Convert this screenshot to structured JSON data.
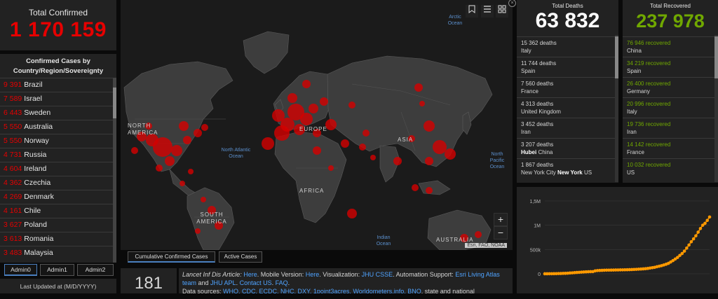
{
  "total_confirmed": {
    "label": "Total Confirmed",
    "value": "1 170 159"
  },
  "country_list": {
    "header": "Confirmed Cases by Country/Region/Sovereignty",
    "items": [
      {
        "value": "9 391",
        "name": "Brazil"
      },
      {
        "value": "7 589",
        "name": "Israel"
      },
      {
        "value": "6 443",
        "name": "Sweden"
      },
      {
        "value": "5 550",
        "name": "Australia"
      },
      {
        "value": "5 550",
        "name": "Norway"
      },
      {
        "value": "4 731",
        "name": "Russia"
      },
      {
        "value": "4 604",
        "name": "Ireland"
      },
      {
        "value": "4 362",
        "name": "Czechia"
      },
      {
        "value": "4 269",
        "name": "Denmark"
      },
      {
        "value": "4 161",
        "name": "Chile"
      },
      {
        "value": "3 627",
        "name": "Poland"
      },
      {
        "value": "3 613",
        "name": "Romania"
      },
      {
        "value": "3 483",
        "name": "Malaysia"
      }
    ]
  },
  "admin_tabs": [
    "Admin0",
    "Admin1",
    "Admin2"
  ],
  "last_updated": {
    "label": "Last Updated at (M/D/YYYY)"
  },
  "map": {
    "labels": {
      "arctic": "Arctic Ocean",
      "north_america": "NORTH AMERICA",
      "europe": "EUROPE",
      "asia": "ASIA",
      "africa": "AFRICA",
      "south_america": "SOUTH AMERICA",
      "australia": "AUSTRALIA",
      "north_atlantic": "North Atlantic Ocean",
      "north_pacific": "North Pacific Ocean",
      "indian": "Indian Ocean"
    },
    "attribution": "Esri, FAO, NOAA",
    "zoom_in": "+",
    "zoom_out": "−",
    "tabs": [
      "Cumulative Confirmed Cases",
      "Active Cases"
    ]
  },
  "countries_count": "181",
  "info": {
    "t1": "Lancet Inf Dis Article: ",
    "l1": "Here",
    "t2": ". Mobile Version: ",
    "l2": "Here",
    "t3": ". Visualization: ",
    "l3": "JHU CSSE",
    "t4": ". Automation Support: ",
    "l4": "Esri Living Atlas team",
    "t5": " and ",
    "l5": "JHU APL",
    "t6": ". ",
    "l6": "Contact US",
    "t7": ". ",
    "l7": "FAQ",
    "t8": ".",
    "t9": "Data sources: ",
    "l9": "WHO, CDC, ECDC, NHC, DXY, 1point3acres, Worldometers.info, BNO",
    "t10": ", state and national"
  },
  "deaths": {
    "label": "Total Deaths",
    "value": "63 832",
    "items": [
      {
        "value": "15 362 deaths",
        "place": "Italy"
      },
      {
        "value": "11 744 deaths",
        "place": "Spain"
      },
      {
        "value": "7 560 deaths",
        "place": "France"
      },
      {
        "value": "4 313 deaths",
        "place": "United Kingdom"
      },
      {
        "value": "3 452 deaths",
        "place": "Iran"
      },
      {
        "value": "3 207 deaths",
        "bold": "Hubei",
        "place": "China"
      },
      {
        "value": "1 867 deaths",
        "prefix": "New York City ",
        "bold": "New York",
        "place": "US"
      }
    ]
  },
  "recovered": {
    "label": "Total Recovered",
    "value": "237 978",
    "items": [
      {
        "value": "76 946 recovered",
        "place": "China"
      },
      {
        "value": "34 219 recovered",
        "place": "Spain"
      },
      {
        "value": "26 400 recovered",
        "place": "Germany"
      },
      {
        "value": "20 996 recovered",
        "place": "Italy"
      },
      {
        "value": "19 736 recovered",
        "place": "Iran"
      },
      {
        "value": "14 142 recovered",
        "place": "France"
      },
      {
        "value": "10 032 recovered",
        "place": "US"
      }
    ]
  },
  "chart_data": {
    "type": "line",
    "title": "",
    "xlabel": "",
    "ylabel": "",
    "yticks": [
      "0",
      "500k",
      "1M",
      "1,5M"
    ],
    "ylim": [
      0,
      1500000
    ],
    "x": [
      1,
      2,
      3,
      4,
      5,
      6,
      7,
      8,
      9,
      10,
      11,
      12,
      13,
      14,
      15,
      16,
      17,
      18,
      19,
      20,
      21,
      22,
      23,
      24,
      25,
      26,
      27,
      28,
      29,
      30,
      31,
      32,
      33,
      34,
      35,
      36,
      37,
      38,
      39,
      40,
      41,
      42,
      43,
      44,
      45,
      46,
      47,
      48,
      49,
      50,
      51,
      52,
      53,
      54,
      55,
      56,
      57,
      58,
      59,
      60,
      61,
      62,
      63,
      64,
      65,
      66,
      67,
      68,
      69,
      70,
      71,
      72,
      73
    ],
    "series": [
      {
        "color": "#ff9900",
        "values": [
          555,
          654,
          941,
          1434,
          2118,
          2927,
          5578,
          6166,
          8234,
          9927,
          12038,
          16787,
          19881,
          23892,
          27635,
          30794,
          34391,
          37120,
          40150,
          42762,
          44802,
          45221,
          60368,
          66885,
          69030,
          71224,
          73258,
          75136,
          75639,
          76197,
          76819,
          78572,
          79339,
          80422,
          81305,
          82720,
          83765,
          85320,
          87375,
          89831,
          91813,
          94942,
          97911,
          101578,
          105383,
          110212,
          118452,
          125838,
          133049,
          145485,
          156112,
          167414,
          181555,
          197102,
          214864,
          242570,
          272208,
          304507,
          336953,
          378235,
          418045,
          467653,
          529591,
          593291,
          660693,
          720140,
          782389,
          857487,
          932605,
          1000000,
          1040000,
          1100000,
          1170159
        ]
      }
    ]
  }
}
